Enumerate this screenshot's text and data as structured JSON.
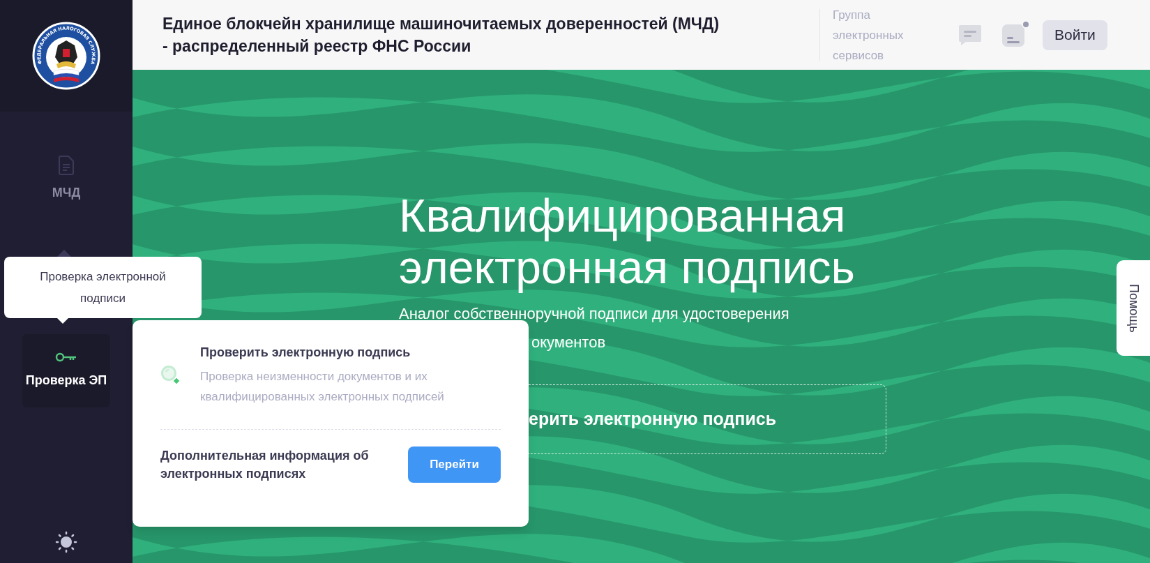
{
  "logo": {
    "text": "ФЕДЕРАЛЬНАЯ НАЛОГОВАЯ СЛУЖБА"
  },
  "sidebar": {
    "items": [
      {
        "label": "МЧД",
        "kind": "document",
        "selected": false
      },
      {
        "label": "Проверка ЭП",
        "kind": "key",
        "selected": true
      }
    ]
  },
  "tooltip": {
    "text": "Проверка электронной подписи"
  },
  "header": {
    "title_lines": [
      "Единое блокчейн хранилище машиночитаемых доверенностей (МЧД)",
      "- распределенный реестр ФНС России"
    ],
    "group_link": "Группа электронных сервисов",
    "notification_dot": true,
    "login_button": "Войти"
  },
  "hero": {
    "title": "Квалифицированная электронная подпись",
    "subtitle": "Аналог собственноручной подписи для удостоверения",
    "subtitle_visible_end": "окументов",
    "action_visible": "ерить электронную подпись"
  },
  "popup": {
    "title": "Проверить электронную подпись",
    "description": "Проверка неизменности документов и их квалифицированных электронных подписей",
    "more_info": "Дополнительная информация об электронных подписях",
    "button": "Перейти"
  },
  "help_tab": {
    "label": "Помощь"
  }
}
